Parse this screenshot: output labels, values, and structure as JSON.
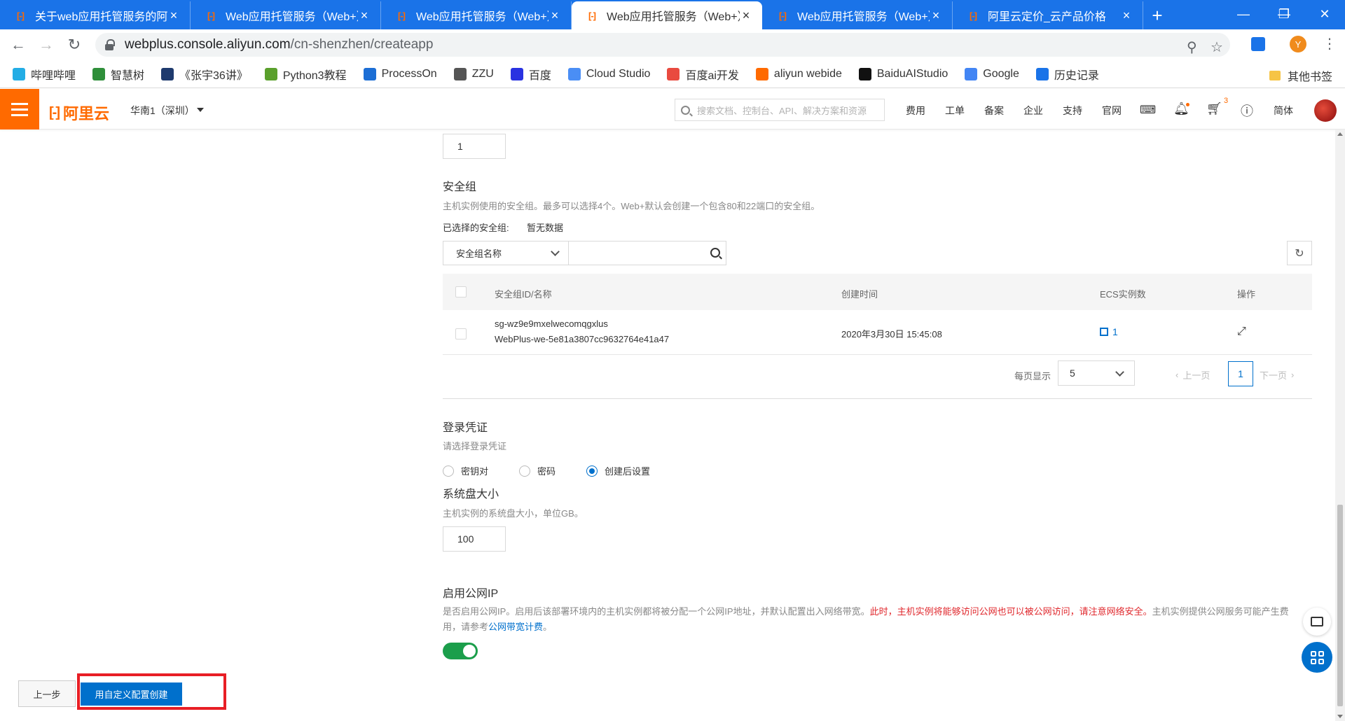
{
  "browser": {
    "tabs": [
      {
        "title": "关于web应用托管服务的阿里",
        "active": false
      },
      {
        "title": "Web应用托管服务（Web+）",
        "active": false
      },
      {
        "title": "Web应用托管服务（Web+）",
        "active": false
      },
      {
        "title": "Web应用托管服务（Web+）",
        "active": true
      },
      {
        "title": "Web应用托管服务（Web+）",
        "active": false
      },
      {
        "title": "阿里云定价_云产品价格",
        "active": false
      }
    ],
    "favicon_glyph": "[-]",
    "close_glyph": "×",
    "new_tab_glyph": "+",
    "window_controls": {
      "minimize": "—",
      "restore": "❐",
      "close": "✕"
    },
    "address": {
      "host": "webplus.console.aliyun.com",
      "path": "/cn-shenzhen/createapp"
    },
    "profile_initial": "Y",
    "bookmarks": [
      {
        "label": "哔哩哔哩",
        "color": "#23ade5"
      },
      {
        "label": "智慧树",
        "color": "#2f8f3a"
      },
      {
        "label": "《张宇36讲》",
        "color": "#1e3a6e"
      },
      {
        "label": "Python3教程",
        "color": "#5aa02c"
      },
      {
        "label": "ProcessOn",
        "color": "#1c6ed5"
      },
      {
        "label": "ZZU",
        "color": "#555555"
      },
      {
        "label": "百度",
        "color": "#2932e1"
      },
      {
        "label": "Cloud Studio",
        "color": "#4a8ef5"
      },
      {
        "label": "百度ai开发",
        "color": "#e94a3f"
      },
      {
        "label": "aliyun webide",
        "color": "#ff6a00"
      },
      {
        "label": "BaiduAIStudio",
        "color": "#111111"
      },
      {
        "label": "Google",
        "color": "#4285f4"
      },
      {
        "label": "历史记录",
        "color": "#1a73e8"
      }
    ],
    "other_bookmarks": "其他书签"
  },
  "console_header": {
    "logo_text": "阿里云",
    "logo_mark": "[-]",
    "region": "华南1（深圳）",
    "search_placeholder": "搜索文档、控制台、API、解决方案和资源",
    "links": [
      "费用",
      "工单",
      "备案",
      "企业",
      "支持",
      "官网"
    ],
    "cart_badge": "3",
    "language": "简体"
  },
  "page": {
    "top_number_value": "1",
    "security_group": {
      "title": "安全组",
      "desc": "主机实例使用的安全组。最多可以选择4个。Web+默认会创建一个包含80和22端口的安全组。",
      "selected_label": "已选择的安全组:",
      "selected_value": "暂无数据",
      "filter_select": "安全组名称",
      "refresh_glyph": "↻",
      "columns": [
        "安全组ID/名称",
        "创建时间",
        "ECS实例数",
        "操作"
      ],
      "rows": [
        {
          "id": "sg-wz9e9mxelwecomqgxlus",
          "name": "WebPlus-we-5e81a3807cc9632764e41a47",
          "created": "2020年3月30日 15:45:08",
          "ecs_count": "1",
          "action_glyph": "⤢"
        }
      ],
      "pager": {
        "per_page_label": "每页显示",
        "per_page": "5",
        "prev": "上一页",
        "next": "下一页",
        "current": "1"
      }
    },
    "login": {
      "title": "登录凭证",
      "desc": "请选择登录凭证",
      "options": [
        {
          "label": "密钥对",
          "checked": false
        },
        {
          "label": "密码",
          "checked": false
        },
        {
          "label": "创建后设置",
          "checked": true
        }
      ]
    },
    "disk": {
      "title": "系统盘大小",
      "desc": "主机实例的系统盘大小，单位GB。",
      "value": "100"
    },
    "public_ip": {
      "title": "启用公网IP",
      "desc_a": "是否启用公网IP。启用后该部署环境内的主机实例都将被分配一个公网IP地址，并默认配置出入网络带宽。",
      "desc_warn": "此时，主机实例将能够访问公网也可以被公网访问，请注意网络安全。",
      "desc_b": "主机实例提供公网服务可能产生费用，请参考",
      "desc_link": "公网带宽计费",
      "desc_end": "。",
      "enabled": true
    },
    "footer": {
      "prev_button": "上一步",
      "create_button": "用自定义配置创建"
    }
  },
  "colors": {
    "brand": "#ff6a00",
    "primary": "#0070cc",
    "toggle_on": "#1b9e4b",
    "highlight_box": "#e81e25",
    "warn": "#e0282d"
  }
}
